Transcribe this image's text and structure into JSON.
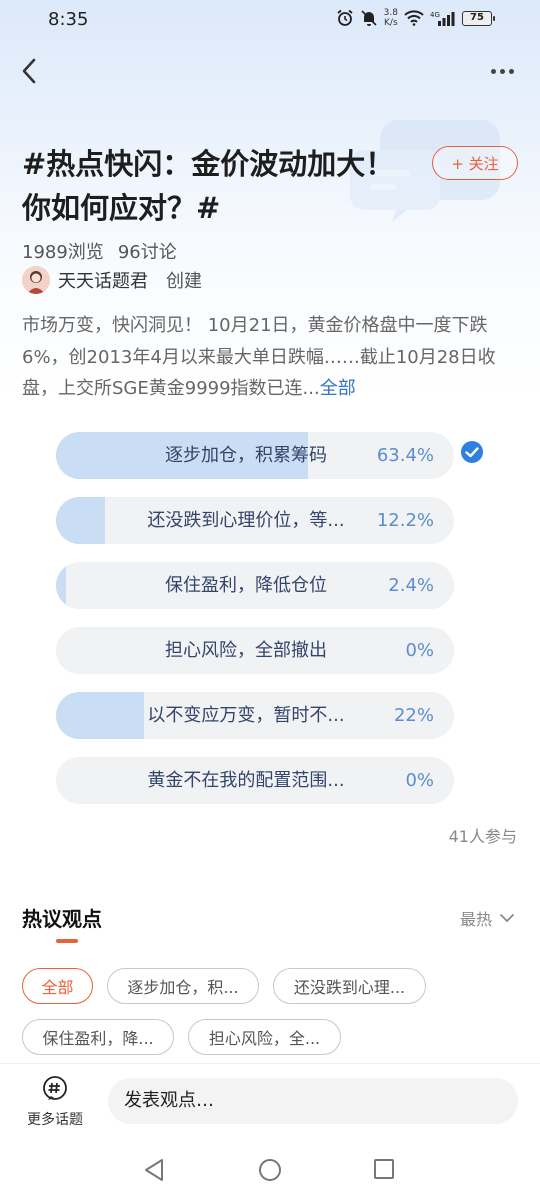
{
  "status_bar": {
    "time": "8:35",
    "net_speed_value": "3.8",
    "net_speed_unit": "K/s",
    "network": "4G",
    "battery": "75"
  },
  "nav": {
    "back_icon": "chevron-left-icon",
    "more_icon": "more-dots-icon"
  },
  "topic": {
    "title": "#热点快闪：金价波动加大！你如何应对？#",
    "follow_label": "+ 关注",
    "views": "1989浏览",
    "discussions": "96讨论",
    "creator_name": "天天话题君",
    "creator_role": "创建",
    "description": "市场万变，快闪洞见！ 10月21日，黄金价格盘中一度下跌6%，创2013年4月以来最大单日跌幅……截止10月28日收盘，上交所SGE黄金9999指数已连...",
    "description_more": "全部"
  },
  "poll": {
    "options": [
      {
        "label": "逐步加仓，积累筹码",
        "percent_text": "63.4%",
        "value": 63.4,
        "selected": true
      },
      {
        "label": "还没跌到心理价位，等...",
        "percent_text": "12.2%",
        "value": 12.2,
        "selected": false
      },
      {
        "label": "保住盈利，降低仓位",
        "percent_text": "2.4%",
        "value": 2.4,
        "selected": false
      },
      {
        "label": "担心风险，全部撤出",
        "percent_text": "0%",
        "value": 0,
        "selected": false
      },
      {
        "label": "以不变应万变，暂时不...",
        "percent_text": "22%",
        "value": 22,
        "selected": false
      },
      {
        "label": "黄金不在我的配置范围...",
        "percent_text": "0%",
        "value": 0,
        "selected": false
      }
    ],
    "participants": "41人参与",
    "fill_color": "#c9ddf5",
    "check_color": "#2f7fe0"
  },
  "discussion": {
    "title": "热议观点",
    "sort_label": "最热",
    "chips": [
      "全部",
      "逐步加仓，积...",
      "还没跌到心理...",
      "保住盈利，降...",
      "担心风险，全..."
    ],
    "active_chip": 0,
    "accent_color": "#e8623a"
  },
  "bottom_bar": {
    "more_topics_label": "更多话题",
    "comment_placeholder": "发表观点…"
  }
}
